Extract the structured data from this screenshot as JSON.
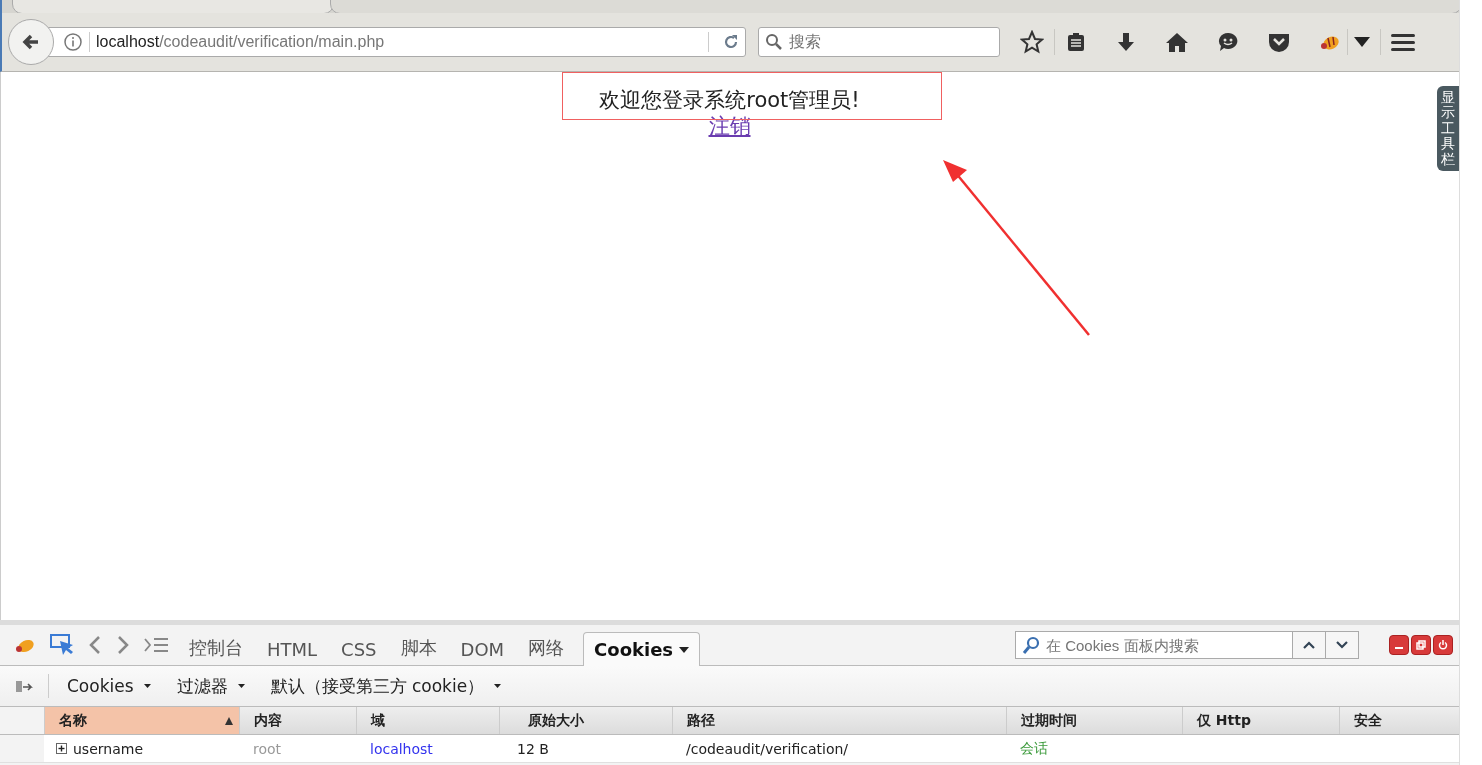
{
  "browser": {
    "url_host": "localhost",
    "url_path": "/codeaudit/verification/main.php",
    "search_placeholder": "搜索"
  },
  "page": {
    "welcome": "欢迎您登录系统root管理员!",
    "logout_link": "注销",
    "toolbar_toggle": "显示工具栏"
  },
  "devtools": {
    "tabs": [
      {
        "label": "控制台",
        "selected": false,
        "has_menu": false
      },
      {
        "label": "HTML",
        "selected": false,
        "has_menu": false
      },
      {
        "label": "CSS",
        "selected": false,
        "has_menu": false
      },
      {
        "label": "脚本",
        "selected": false,
        "has_menu": false
      },
      {
        "label": "DOM",
        "selected": false,
        "has_menu": false
      },
      {
        "label": "网络",
        "selected": false,
        "has_menu": false
      },
      {
        "label": "Cookies",
        "selected": true,
        "has_menu": true
      }
    ],
    "search_placeholder": "在 Cookies 面板内搜索",
    "menus": [
      "Cookies",
      "过滤器",
      "默认（接受第三方 cookie）"
    ],
    "columns": [
      {
        "label": "名称",
        "sorted": true
      },
      {
        "label": "内容",
        "sorted": false
      },
      {
        "label": "域",
        "sorted": false
      },
      {
        "label": "原始大小",
        "sorted": false
      },
      {
        "label": "路径",
        "sorted": false
      },
      {
        "label": "过期时间",
        "sorted": false
      },
      {
        "label": "仅 Http",
        "sorted": false
      },
      {
        "label": "安全",
        "sorted": false
      }
    ],
    "rows": [
      {
        "expanded": false,
        "name": "username",
        "value": "root",
        "domain": "localhost",
        "raw_size": "12 B",
        "path": "/codeaudit/verification/",
        "expires": "会话"
      }
    ]
  }
}
